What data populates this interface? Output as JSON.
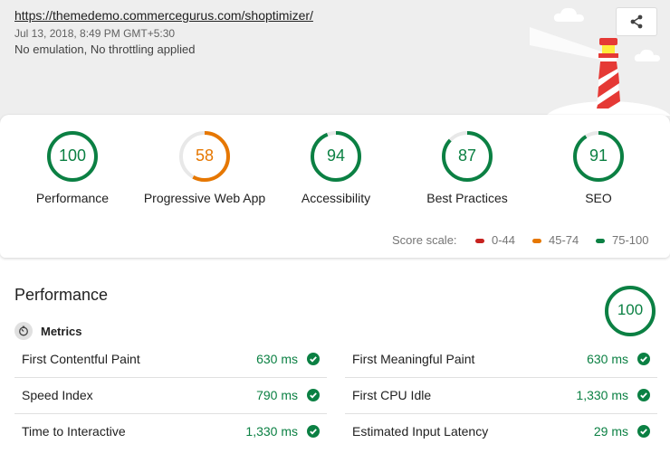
{
  "header": {
    "url": "https://themedemo.commercegurus.com/shoptimizer/",
    "date": "Jul 13, 2018, 8:49 PM GMT+5:30",
    "environment": "No emulation, No throttling applied"
  },
  "gauges": [
    {
      "score": "100",
      "label": "Performance",
      "fraction": 1.0,
      "color": "#0b8043"
    },
    {
      "score": "58",
      "label": "Progressive Web App",
      "fraction": 0.58,
      "color": "#e67700"
    },
    {
      "score": "94",
      "label": "Accessibility",
      "fraction": 0.94,
      "color": "#0b8043"
    },
    {
      "score": "87",
      "label": "Best Practices",
      "fraction": 0.87,
      "color": "#0b8043"
    },
    {
      "score": "91",
      "label": "SEO",
      "fraction": 0.91,
      "color": "#0b8043"
    }
  ],
  "score_scale": {
    "label": "Score scale:",
    "ranges": [
      {
        "text": "0-44",
        "color": "#c7221f"
      },
      {
        "text": "45-74",
        "color": "#e67700"
      },
      {
        "text": "75-100",
        "color": "#0b8043"
      }
    ]
  },
  "performance": {
    "title": "Performance",
    "score": "100",
    "fraction": 1.0,
    "metrics_heading": "Metrics",
    "metrics": [
      {
        "label": "First Contentful Paint",
        "value": "630 ms"
      },
      {
        "label": "First Meaningful Paint",
        "value": "630 ms"
      },
      {
        "label": "Speed Index",
        "value": "790 ms"
      },
      {
        "label": "First CPU Idle",
        "value": "1,330 ms"
      },
      {
        "label": "Time to Interactive",
        "value": "1,330 ms"
      },
      {
        "label": "Estimated Input Latency",
        "value": "29 ms"
      }
    ]
  }
}
